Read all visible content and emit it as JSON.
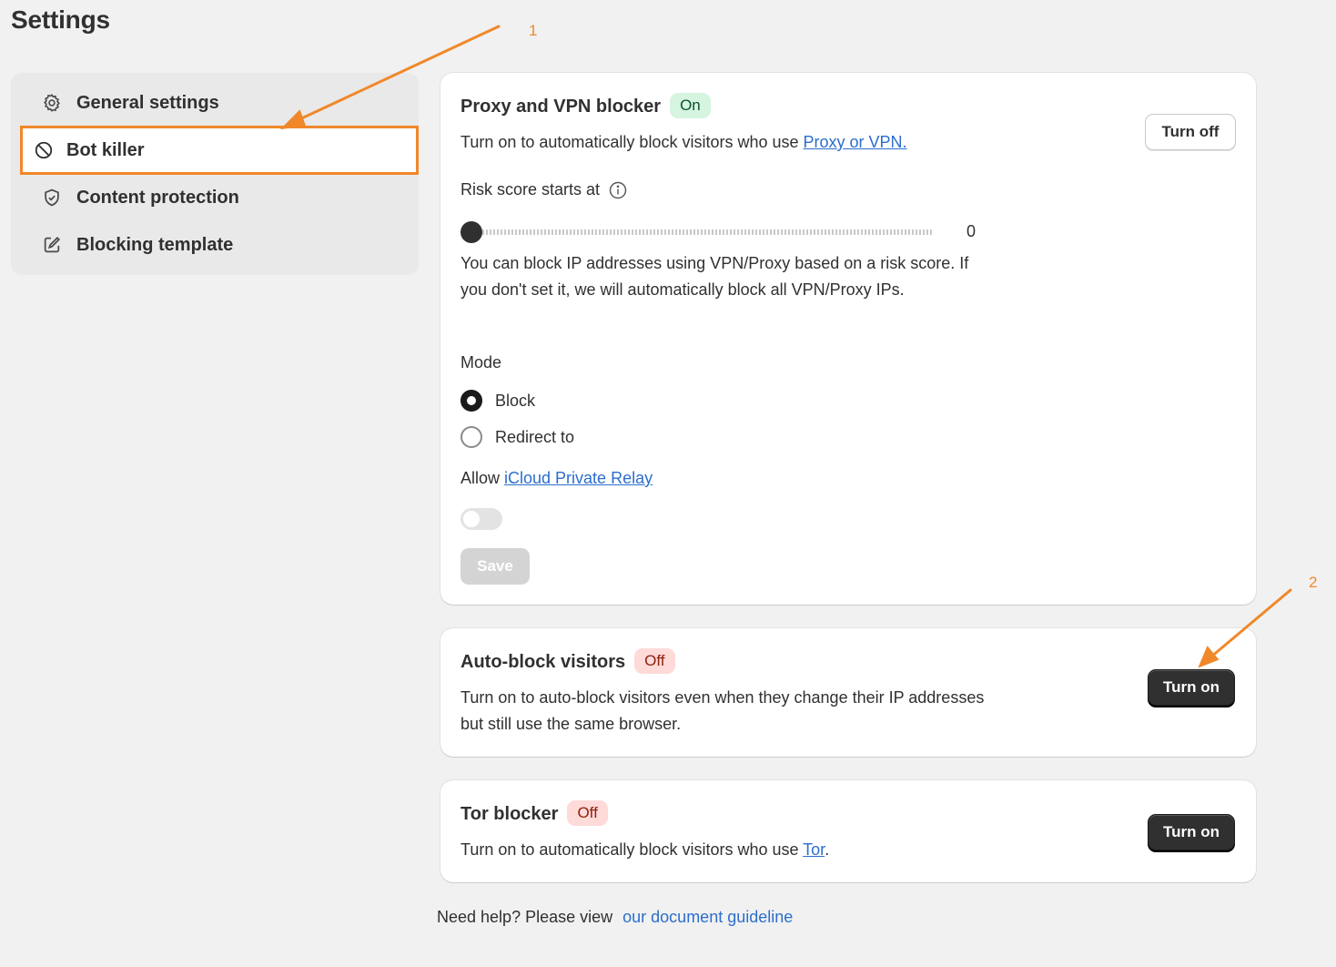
{
  "page": {
    "title": "Settings"
  },
  "sidebar": {
    "items": [
      {
        "label": "General settings",
        "icon": "gear-icon"
      },
      {
        "label": "Bot killer",
        "icon": "block-icon",
        "active": true
      },
      {
        "label": "Content protection",
        "icon": "shield-check-icon"
      },
      {
        "label": "Blocking template",
        "icon": "edit-icon"
      }
    ]
  },
  "proxy_card": {
    "title": "Proxy and VPN blocker",
    "status": "On",
    "button": "Turn off",
    "desc_prefix": "Turn on to automatically block visitors who use ",
    "desc_link": "Proxy or VPN.",
    "risk_label": "Risk score starts at",
    "risk_value": "0",
    "risk_help": "You can block IP addresses using VPN/Proxy based on a risk score. If you don't set it, we will automatically block all VPN/Proxy IPs.",
    "mode_label": "Mode",
    "mode_options": [
      "Block",
      "Redirect to"
    ],
    "mode_selected": "Block",
    "allow_prefix": "Allow ",
    "allow_link": "iCloud Private Relay",
    "allow_enabled": false,
    "save_label": "Save"
  },
  "autoblock_card": {
    "title": "Auto-block visitors",
    "status": "Off",
    "button": "Turn on",
    "desc": "Turn on to auto-block visitors even when they change their IP addresses but still use the same browser."
  },
  "tor_card": {
    "title": "Tor blocker",
    "status": "Off",
    "button": "Turn on",
    "desc_prefix": "Turn on to automatically block visitors who use ",
    "desc_link": "Tor",
    "desc_suffix": "."
  },
  "help": {
    "text": "Need help? Please view",
    "link": "our document guideline"
  },
  "annotations": {
    "label_1": "1",
    "label_2": "2",
    "color": "#f0882a"
  }
}
